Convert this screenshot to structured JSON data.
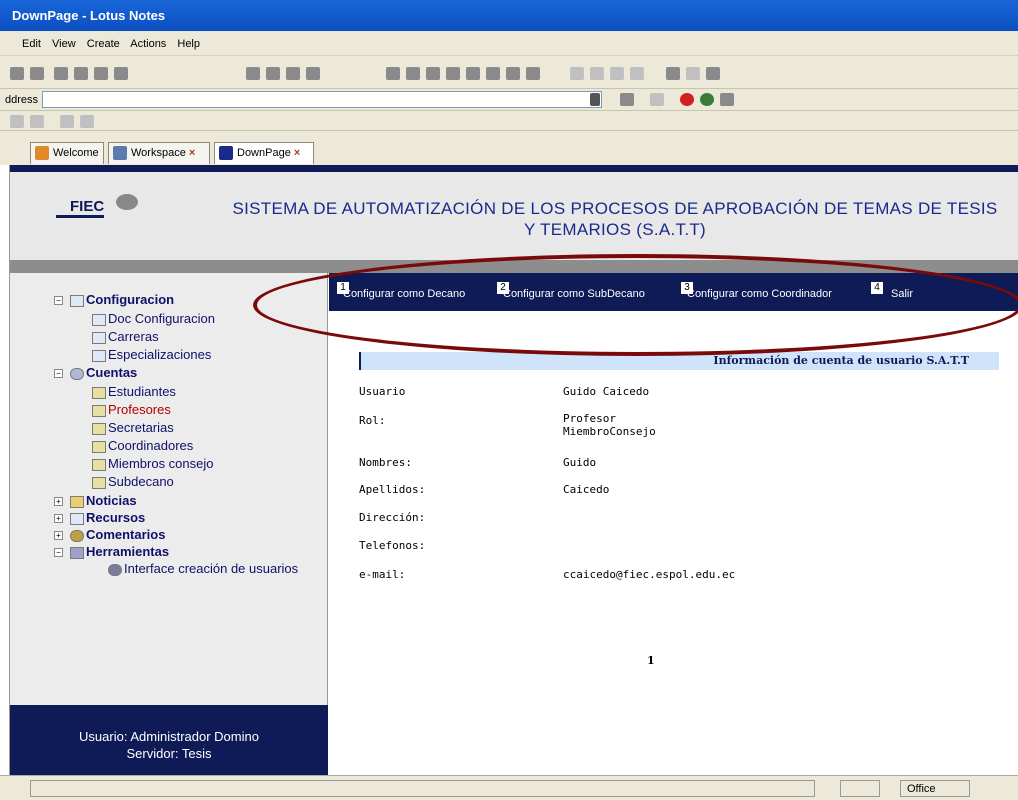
{
  "window": {
    "title": "DownPage - Lotus Notes"
  },
  "menu": [
    "Edit",
    "View",
    "Create",
    "Actions",
    "Help"
  ],
  "address": {
    "label": "ddress",
    "value": ""
  },
  "tabs": [
    {
      "label": "Welcome",
      "icon": "home-icon"
    },
    {
      "label": "Workspace",
      "icon": "workspace-icon"
    },
    {
      "label": "DownPage",
      "icon": "page-icon"
    }
  ],
  "header": {
    "logo": "FIEC",
    "title": "SISTEMA DE AUTOMATIZACIÓN DE LOS PROCESOS DE APROBACIÓN DE TEMAS DE TESIS Y TEMARIOS (S.A.T.T)"
  },
  "tree": {
    "configuracion": "Configuracion",
    "doc_configuracion": "Doc Configuracion",
    "carreras": "Carreras",
    "especializaciones": "Especializaciones",
    "cuentas": "Cuentas",
    "estudiantes": "Estudiantes",
    "profesores": "Profesores",
    "secretarias": "Secretarias",
    "coordinadores": "Coordinadores",
    "miembros_consejo": "Miembros consejo",
    "subdecano": "Subdecano",
    "noticias": "Noticias",
    "recursos": "Recursos",
    "comentarios": "Comentarios",
    "herramientas": "Herramientas",
    "interface": "Interface creación de usuarios"
  },
  "sidebar_footer": {
    "usuario": "Usuario: Administrador Domino",
    "servidor": "Servidor: Tesis"
  },
  "actions": [
    {
      "num": "1",
      "label": "Configurar como Decano"
    },
    {
      "num": "2",
      "label": "Configurar como SubDecano"
    },
    {
      "num": "3",
      "label": "Configurar como Coordinador"
    },
    {
      "num": "4",
      "label": "Salir"
    }
  ],
  "info": {
    "heading": "Información de cuenta de usuario S.A.T.T",
    "usuario_label": "Usuario",
    "usuario_value": "Guido Caicedo",
    "rol_label": "Rol:",
    "rol_value_1": "Profesor",
    "rol_value_2": "MiembroConsejo",
    "nombres_label": "Nombres:",
    "nombres_value": "Guido",
    "apellidos_label": "Apellidos:",
    "apellidos_value": "Caicedo",
    "direccion_label": "Dirección:",
    "telefonos_label": "Telefonos:",
    "email_label": "e-mail:",
    "email_value": "ccaicedo@fiec.espol.edu.ec"
  },
  "page_number": "1",
  "status": {
    "location": "Office"
  }
}
